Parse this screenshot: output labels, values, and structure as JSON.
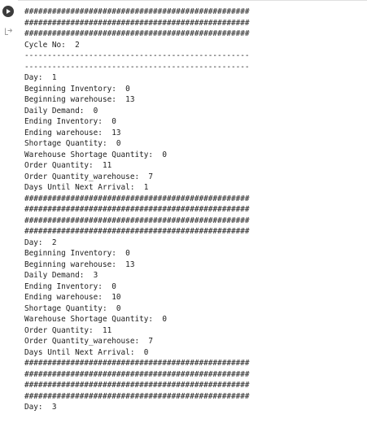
{
  "cell": {
    "run_button_icon": "play-icon",
    "output_icon": "output-redirect-icon"
  },
  "output": {
    "lines": [
      "#################################################",
      "#################################################",
      "#################################################",
      "Cycle No:  2",
      "-------------------------------------------------",
      "-------------------------------------------------",
      "Day:  1",
      "Beginning Inventory:  0",
      "Beginning warehouse:  13",
      "Daily Demand:  0",
      "Ending Inventory:  0",
      "Ending warehouse:  13",
      "Shortage Quantity:  0",
      "Warehouse Shortage Quantity:  0",
      "Order Quantity:  11",
      "Order Quantity_warehouse:  7",
      "Days Until Next Arrival:  1",
      "#################################################",
      "#################################################",
      "#################################################",
      "#################################################",
      "Day:  2",
      "Beginning Inventory:  0",
      "Beginning warehouse:  13",
      "Daily Demand:  3",
      "Ending Inventory:  0",
      "Ending warehouse:  10",
      "Shortage Quantity:  0",
      "Warehouse Shortage Quantity:  0",
      "Order Quantity:  11",
      "Order Quantity_warehouse:  7",
      "Days Until Next Arrival:  0",
      "#################################################",
      "#################################################",
      "#################################################",
      "#################################################",
      "Day:  3"
    ]
  }
}
